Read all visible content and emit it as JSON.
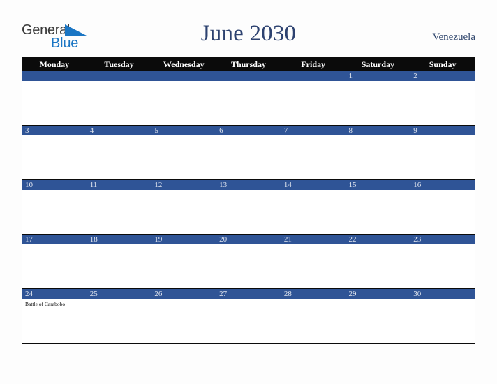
{
  "brand": {
    "name_part1": "General",
    "name_part2": "Blue",
    "mark": "triangle-logo-icon",
    "color_dark": "#3a3a3a",
    "color_blue": "#1b76c4"
  },
  "header": {
    "title": "June 2030",
    "country": "Venezuela",
    "title_color": "#2d4270"
  },
  "calendar": {
    "weekdays": [
      "Monday",
      "Tuesday",
      "Wednesday",
      "Thursday",
      "Friday",
      "Saturday",
      "Sunday"
    ],
    "header_bg": "#0b0b0b",
    "date_band_bg": "#2f5496",
    "date_text_color": "#dfe4ee",
    "weeks": [
      [
        {
          "day": "",
          "empty": true,
          "events": []
        },
        {
          "day": "",
          "empty": true,
          "events": []
        },
        {
          "day": "",
          "empty": true,
          "events": []
        },
        {
          "day": "",
          "empty": true,
          "events": []
        },
        {
          "day": "",
          "empty": true,
          "events": []
        },
        {
          "day": "1",
          "empty": false,
          "events": []
        },
        {
          "day": "2",
          "empty": false,
          "events": []
        }
      ],
      [
        {
          "day": "3",
          "empty": false,
          "events": []
        },
        {
          "day": "4",
          "empty": false,
          "events": []
        },
        {
          "day": "5",
          "empty": false,
          "events": []
        },
        {
          "day": "6",
          "empty": false,
          "events": []
        },
        {
          "day": "7",
          "empty": false,
          "events": []
        },
        {
          "day": "8",
          "empty": false,
          "events": []
        },
        {
          "day": "9",
          "empty": false,
          "events": []
        }
      ],
      [
        {
          "day": "10",
          "empty": false,
          "events": []
        },
        {
          "day": "11",
          "empty": false,
          "events": []
        },
        {
          "day": "12",
          "empty": false,
          "events": []
        },
        {
          "day": "13",
          "empty": false,
          "events": []
        },
        {
          "day": "14",
          "empty": false,
          "events": []
        },
        {
          "day": "15",
          "empty": false,
          "events": []
        },
        {
          "day": "16",
          "empty": false,
          "events": []
        }
      ],
      [
        {
          "day": "17",
          "empty": false,
          "events": []
        },
        {
          "day": "18",
          "empty": false,
          "events": []
        },
        {
          "day": "19",
          "empty": false,
          "events": []
        },
        {
          "day": "20",
          "empty": false,
          "events": []
        },
        {
          "day": "21",
          "empty": false,
          "events": []
        },
        {
          "day": "22",
          "empty": false,
          "events": []
        },
        {
          "day": "23",
          "empty": false,
          "events": []
        }
      ],
      [
        {
          "day": "24",
          "empty": false,
          "events": [
            "Battle of Carabobo"
          ]
        },
        {
          "day": "25",
          "empty": false,
          "events": []
        },
        {
          "day": "26",
          "empty": false,
          "events": []
        },
        {
          "day": "27",
          "empty": false,
          "events": []
        },
        {
          "day": "28",
          "empty": false,
          "events": []
        },
        {
          "day": "29",
          "empty": false,
          "events": []
        },
        {
          "day": "30",
          "empty": false,
          "events": []
        }
      ]
    ]
  }
}
